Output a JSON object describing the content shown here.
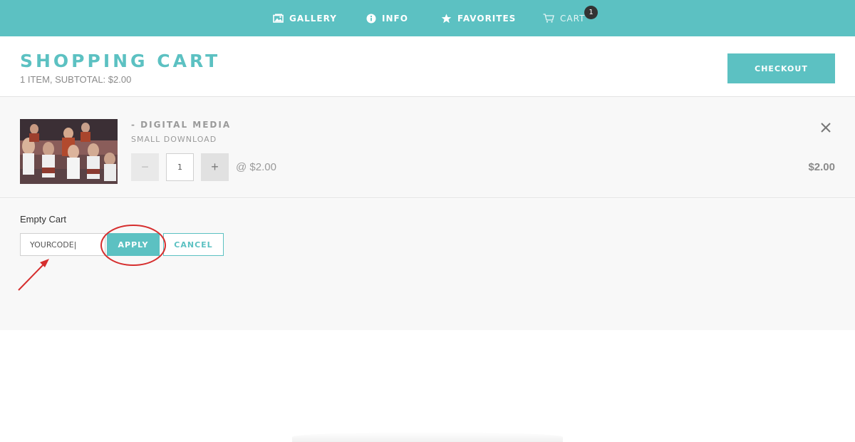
{
  "nav": {
    "gallery": "GALLERY",
    "info": "INFO",
    "favorites": "FAVORITES",
    "cart": "CART",
    "cart_count": "1"
  },
  "header": {
    "title": "SHOPPING CART",
    "subtotal": "1 ITEM, SUBTOTAL: $2.00",
    "checkout_label": "CHECKOUT"
  },
  "item": {
    "name": "- DIGITAL MEDIA",
    "variant": "SMALL DOWNLOAD",
    "quantity": "1",
    "minus_label": "−",
    "plus_label": "+",
    "unit_price": "@  $2.00",
    "line_total": "$2.00"
  },
  "coupon": {
    "empty_cart_label": "Empty Cart",
    "code_value": "YOURCODE|",
    "apply_label": "APPLY",
    "cancel_label": "CANCEL"
  },
  "colors": {
    "brand": "#5cc1c2",
    "annotation": "#d62e2e",
    "badge": "#333333"
  },
  "icons": {
    "gallery": "gallery-icon",
    "info": "info-icon",
    "favorites": "star-icon",
    "cart": "cart-icon",
    "remove": "close-icon"
  }
}
